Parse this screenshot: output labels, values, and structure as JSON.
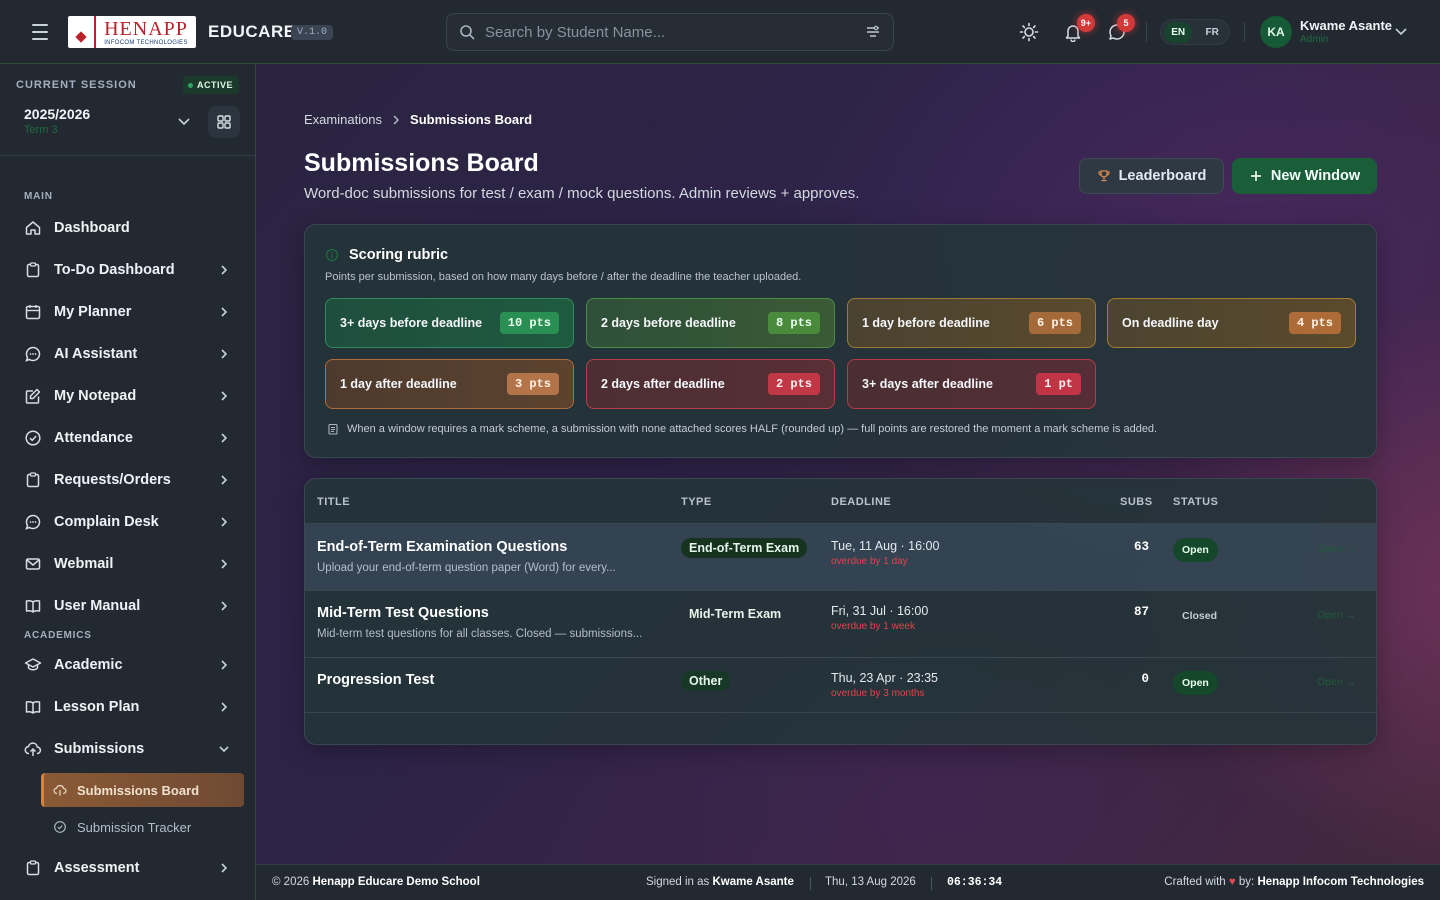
{
  "header": {
    "logo_main": "HENAPP",
    "logo_sub": "INFOCOM TECHNOLOGIES",
    "brand": "EDUCARE",
    "version": "V.1.0",
    "search_placeholder": "Search by Student Name...",
    "notifications_count": "9+",
    "messages_count": "5",
    "lang_en": "EN",
    "lang_fr": "FR",
    "user_initials": "KA",
    "user_name": "Kwame Asante",
    "user_role": "Admin"
  },
  "sidebar": {
    "session_label": "CURRENT SESSION",
    "session_status": "ACTIVE",
    "session_year": "2025/2026",
    "session_term": "Term 3",
    "section_main": "MAIN",
    "section_academics": "ACADEMICS",
    "items": {
      "dashboard": "Dashboard",
      "todo": "To-Do Dashboard",
      "planner": "My Planner",
      "ai": "AI Assistant",
      "notepad": "My Notepad",
      "attendance": "Attendance",
      "requests": "Requests/Orders",
      "complain": "Complain Desk",
      "webmail": "Webmail",
      "manual": "User Manual",
      "academic": "Academic",
      "lesson": "Lesson Plan",
      "submissions": "Submissions",
      "assessment": "Assessment"
    },
    "sub_items": {
      "board": "Submissions Board",
      "tracker": "Submission Tracker"
    }
  },
  "breadcrumb": {
    "parent": "Examinations",
    "current": "Submissions Board"
  },
  "page": {
    "title": "Submissions Board",
    "subtitle": "Word-doc submissions for test / exam / mock questions. Admin reviews + approves.",
    "leaderboard_btn": "Leaderboard",
    "new_window_btn": "New Window"
  },
  "rubric": {
    "title": "Scoring rubric",
    "subtitle": "Points per submission, based on how many days before / after the deadline the teacher uploaded.",
    "tiers": [
      {
        "label": "3+ days before deadline",
        "pts": "10 pts"
      },
      {
        "label": "2 days before deadline",
        "pts": "8 pts"
      },
      {
        "label": "1 day before deadline",
        "pts": "6 pts"
      },
      {
        "label": "On deadline day",
        "pts": "4 pts"
      },
      {
        "label": "1 day after deadline",
        "pts": "3 pts"
      },
      {
        "label": "2 days after deadline",
        "pts": "2 pts"
      },
      {
        "label": "3+ days after deadline",
        "pts": "1 pt"
      }
    ],
    "note": "When a window requires a mark scheme, a submission with none attached scores HALF (rounded up) — full points are restored the moment a mark scheme is added."
  },
  "table": {
    "headers": {
      "title": "TITLE",
      "type": "TYPE",
      "deadline": "DEADLINE",
      "subs": "SUBS",
      "status": "STATUS"
    },
    "rows": [
      {
        "title": "End-of-Term Examination Questions",
        "desc": "Upload your end-of-term question paper (Word) for every...",
        "type": "End-of-Term Exam",
        "deadline": "Tue, 11 Aug · 16:00",
        "overdue": "overdue by 1 day",
        "subs": "63",
        "status": "Open",
        "action": "Open →"
      },
      {
        "title": "Mid-Term Test Questions",
        "desc": "Mid-term test questions for all classes. Closed — submissions...",
        "type": "Mid-Term Exam",
        "deadline": "Fri, 31 Jul · 16:00",
        "overdue": "overdue by 1 week",
        "subs": "87",
        "status": "Closed",
        "action": "Open →"
      },
      {
        "title": "Progression Test",
        "desc": "",
        "type": "Other",
        "deadline": "Thu, 23 Apr · 23:35",
        "overdue": "overdue by 3 months",
        "subs": "0",
        "status": "Open",
        "action": "Open →"
      }
    ]
  },
  "footer": {
    "copyright_prefix": "© 2026",
    "school": "Henapp Educare Demo School",
    "signed_prefix": "Signed in as",
    "signed_user": "Kwame Asante",
    "date": "Thu, 13 Aug 2026",
    "time": "06:36:34",
    "crafted_prefix": "Crafted with",
    "crafted_by": "by:",
    "company": "Henapp Infocom Technologies"
  },
  "colors": {
    "accent_green": "#1a5e39",
    "active_orange": "#d7833c",
    "danger_red": "#e0434c"
  }
}
